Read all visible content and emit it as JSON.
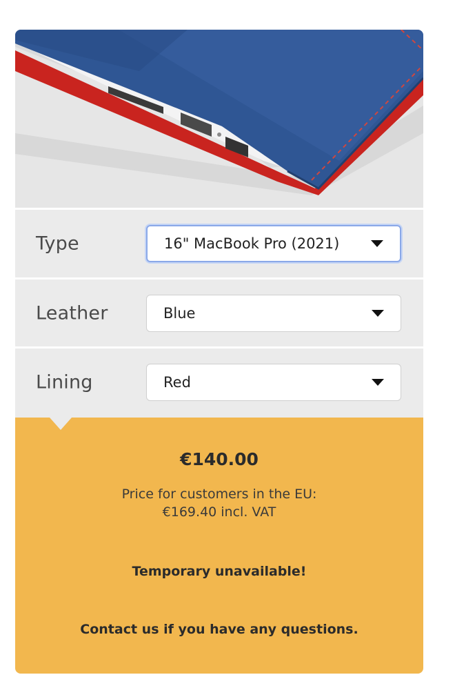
{
  "product_image": {
    "icon": "laptop-sleeve-photo",
    "leather_color": "#2f5694",
    "lining_color": "#d2302a"
  },
  "options": [
    {
      "label": "Type",
      "value": "16\" MacBook Pro (2021)"
    },
    {
      "label": "Leather",
      "value": "Blue"
    },
    {
      "label": "Lining",
      "value": "Red"
    }
  ],
  "pricing": {
    "price": "€140.00",
    "eu_line_1": "Price for customers in the EU:",
    "eu_line_2": "€169.40 incl. VAT",
    "status": "Temporary unavailable!",
    "contact": "Contact us if you have any questions.",
    "panel_color": "#f2b74e"
  }
}
